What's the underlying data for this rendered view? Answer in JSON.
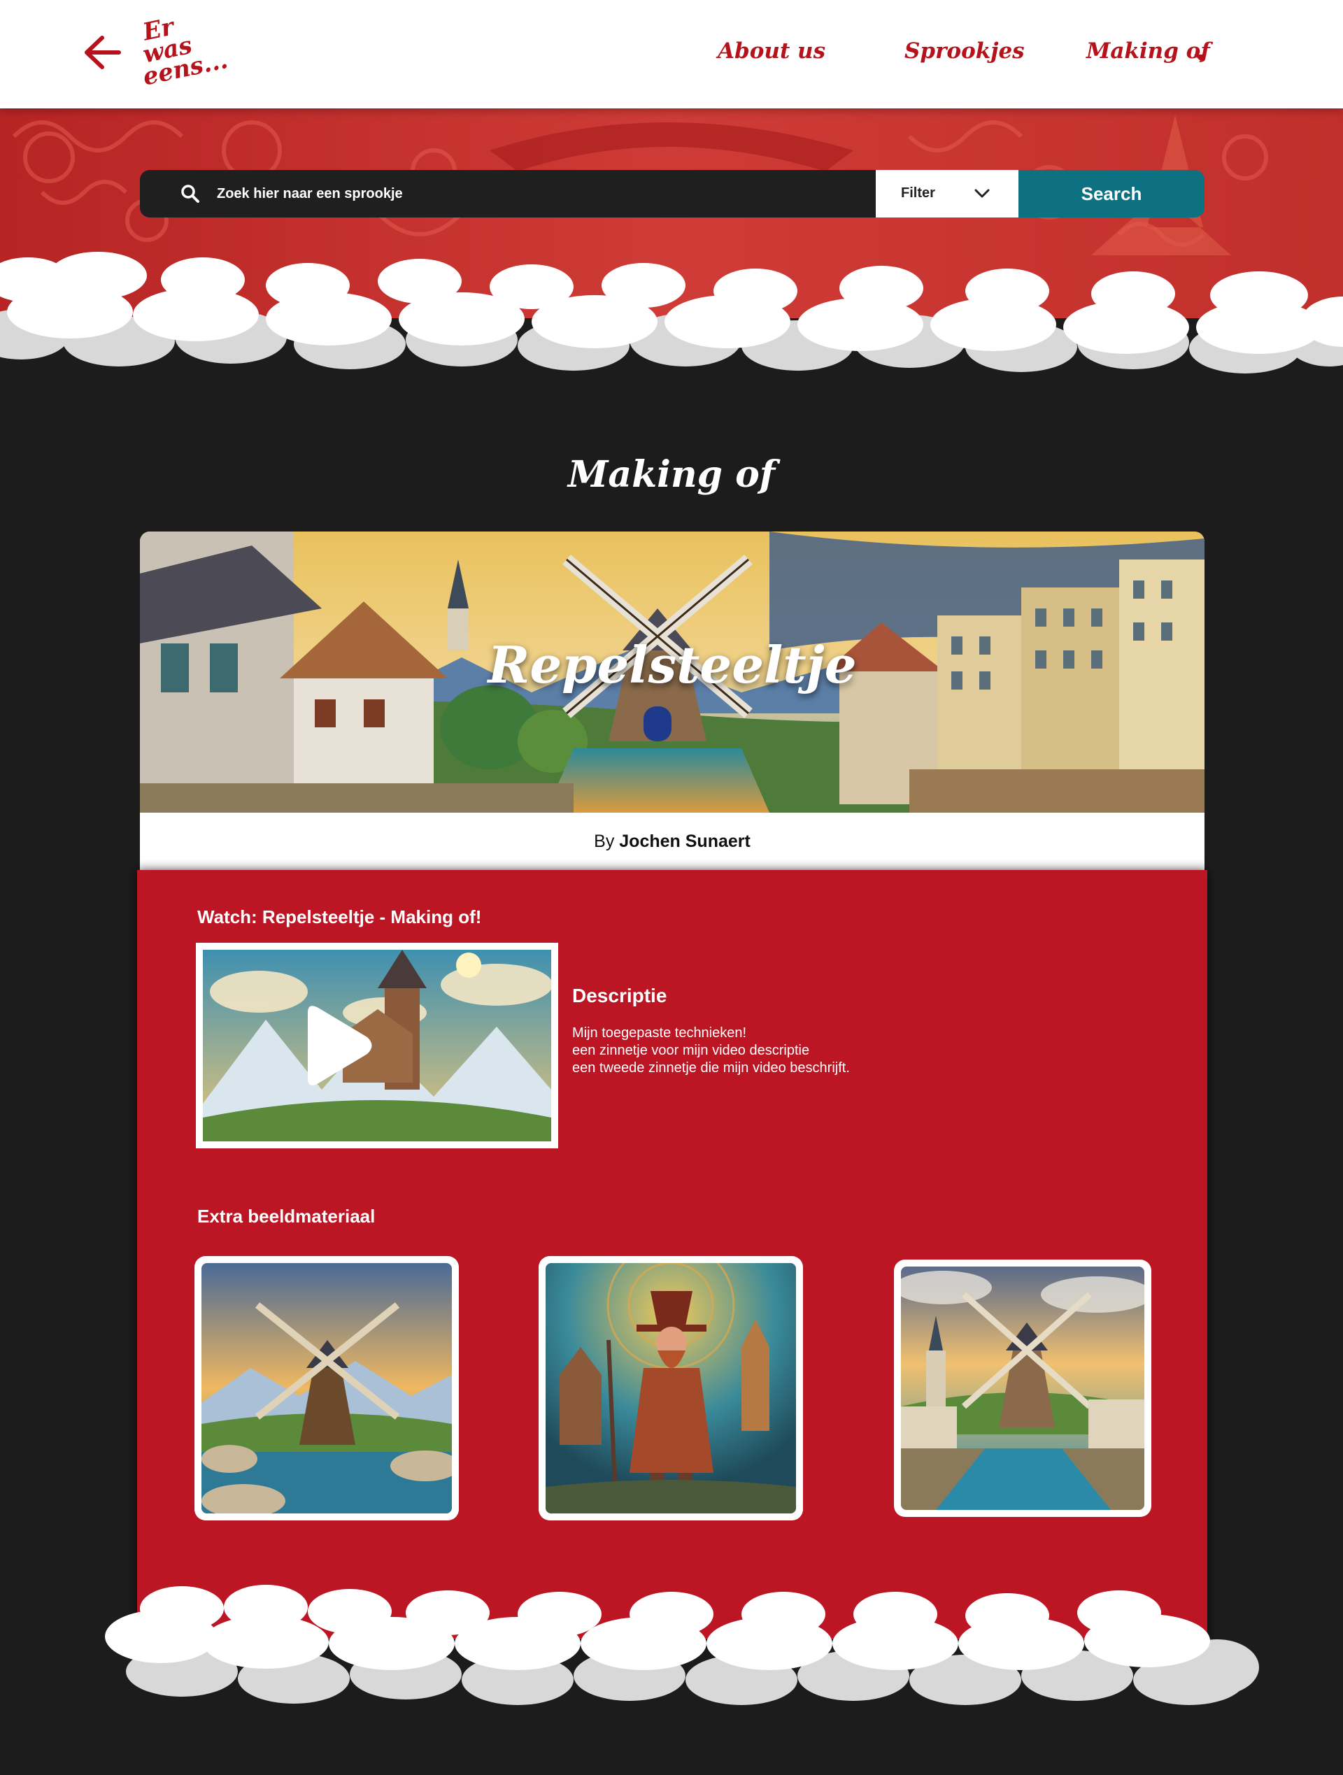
{
  "header": {
    "logo_text": [
      "Er",
      "was",
      "eens..."
    ],
    "nav": [
      {
        "label": "About us"
      },
      {
        "label": "Sprookjes"
      },
      {
        "label": "Making of"
      }
    ]
  },
  "search": {
    "placeholder": "Zoek hier naar een sprookje",
    "filter_label": "Filter",
    "button_label": "Search"
  },
  "page": {
    "title": "Making of",
    "story_title": "Repelsteeltje",
    "by_prefix": "By",
    "author": "Jochen Sunaert"
  },
  "video_section": {
    "heading": "Watch: Repelsteeltje - Making of!",
    "description_title": "Descriptie",
    "description_lines": [
      "Mijn toegepaste technieken!",
      "een zinnetje voor mijn video descriptie",
      "een tweede zinnetje die mijn video beschrijft."
    ]
  },
  "extra": {
    "heading": "Extra beeldmateriaal"
  },
  "colors": {
    "brand_red": "#b5121b",
    "panel_red": "#bc1523",
    "search_teal": "#0e7181",
    "dark_bg": "#1c1c1c"
  }
}
